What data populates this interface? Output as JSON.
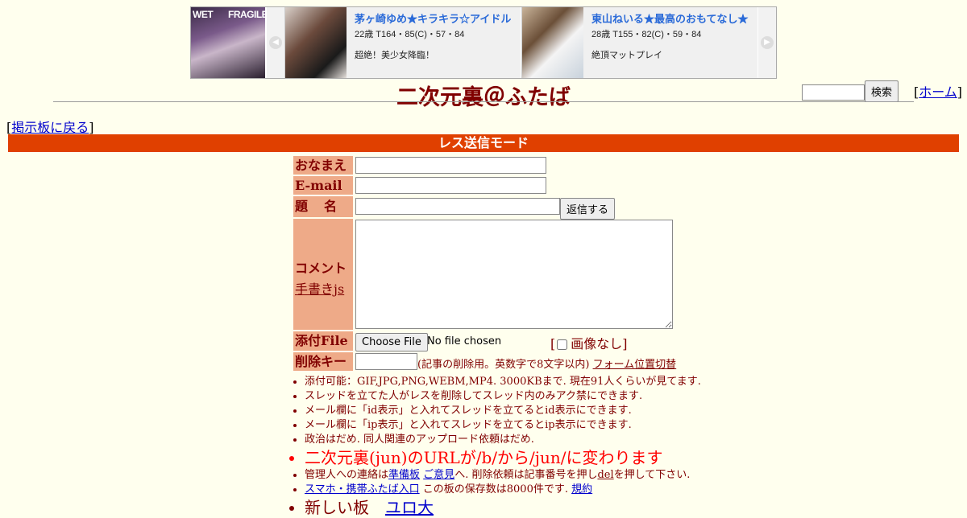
{
  "ad": {
    "cover_word1": "WET",
    "cover_word2": "FRAGILE",
    "items": [
      {
        "name": "茅ヶ崎ゆめ★キラキラ☆アイドル",
        "spec": "22歳 T164・85(C)・57・84",
        "catch": "超絶！美少女降臨！"
      },
      {
        "name": "東山ねいる★最高のおもてなし★",
        "spec": "28歳 T155・82(C)・59・84",
        "catch": "絶頂マットプレイ"
      }
    ]
  },
  "header": {
    "title": "二次元裏＠ふたば",
    "search_button": "検索",
    "home_link": "ホーム",
    "back_link": "掲示板に戻る"
  },
  "mode_bar": "レス送信モード",
  "form": {
    "name_label": "おなまえ",
    "email_label": "E-mail",
    "subject_label": "題　名",
    "submit_button": "返信する",
    "comment_label": "コメント",
    "tegaki_link": "手書きjs",
    "file_label": "添付File",
    "file_button": "Choose File",
    "file_status": "No file chosen",
    "no_image_label": "画像なし",
    "delkey_label": "削除キー",
    "delkey_note": "(記事の削除用。英数字で8文字以内)",
    "form_toggle_link": "フォーム位置切替"
  },
  "rules": [
    "添付可能：GIF,JPG,PNG,WEBM,MP4. 3000KBまで. 現在91人くらいが見てます.",
    "スレッドを立てた人がレスを削除してスレッド内のみアク禁にできます.",
    "メール欄に「id表示」と入れてスレッドを立てるとid表示にできます.",
    "メール欄に「ip表示」と入れてスレッドを立てるとip表示にできます.",
    "政治はだめ. 同人関連のアップロード依頼はだめ."
  ],
  "notice_big": "二次元裏(jun)のURLが/b/から/jun/に変わります",
  "admin_line": {
    "prefix": "管理人への連絡は",
    "link1": "準備板",
    "link2": "ご意見",
    "middle": "へ. 削除依頼は記事番号を押し",
    "del_link": "del",
    "suffix": "を押して下さい."
  },
  "mobile_line": {
    "link": "スマホ・携帯ふたば入口",
    "text": " この板の保存数は8000件です.",
    "rules_link": "規約"
  },
  "cutoff_line": {
    "text": "新しい板",
    "link": "ユロ大"
  }
}
